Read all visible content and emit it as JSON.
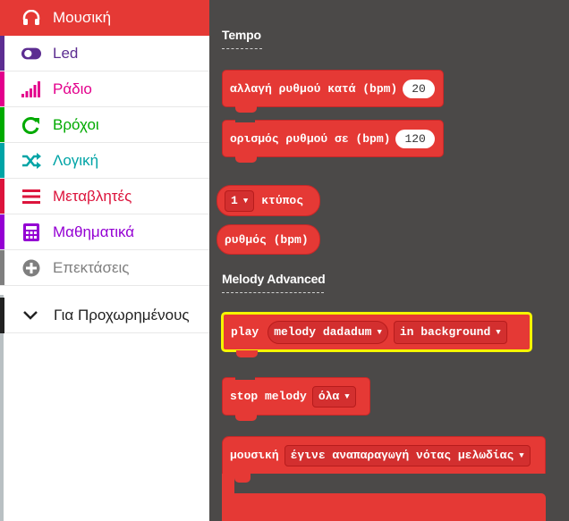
{
  "sidebar": {
    "categories": [
      {
        "label": "Μουσική",
        "icon": "headphones-icon",
        "color": "#e53935",
        "selected": true
      },
      {
        "label": "Led",
        "icon": "toggle-icon",
        "color": "#5c2d91"
      },
      {
        "label": "Ράδιο",
        "icon": "signal-bars-icon",
        "color": "#e3008c"
      },
      {
        "label": "Βρόχοι",
        "icon": "loop-icon",
        "color": "#00aa00"
      },
      {
        "label": "Λογική",
        "icon": "shuffle-icon",
        "color": "#00a4a6"
      },
      {
        "label": "Μεταβλητές",
        "icon": "list-icon",
        "color": "#dc143c"
      },
      {
        "label": "Μαθηματικά",
        "icon": "calculator-icon",
        "color": "#9400d3"
      },
      {
        "label": "Επεκτάσεις",
        "icon": "plus-circle-icon",
        "color": "#7f7f7f"
      }
    ],
    "advanced": {
      "label": "Για Προχωρημένους",
      "icon": "chevron-down-icon"
    }
  },
  "flyout": {
    "tempo_heading": "Tempo",
    "change_tempo": {
      "text": "αλλαγή ρυθμού κατά (bpm)",
      "value": "20"
    },
    "set_tempo": {
      "text": "ορισμός ρυθμού σε (bpm)",
      "value": "120"
    },
    "beat": {
      "value": "1",
      "text": "κτύπος"
    },
    "tempo_reporter": "ρυθμός (bpm)",
    "melody_heading": "Melody Advanced",
    "play": {
      "text": "play",
      "melody": "melody dadadum",
      "mode": "in background"
    },
    "stop": {
      "text": "stop melody",
      "option": "όλα"
    },
    "on_event": {
      "text": "μουσική",
      "option": "έγινε αναπαραγωγή νότας μελωδίας"
    }
  }
}
